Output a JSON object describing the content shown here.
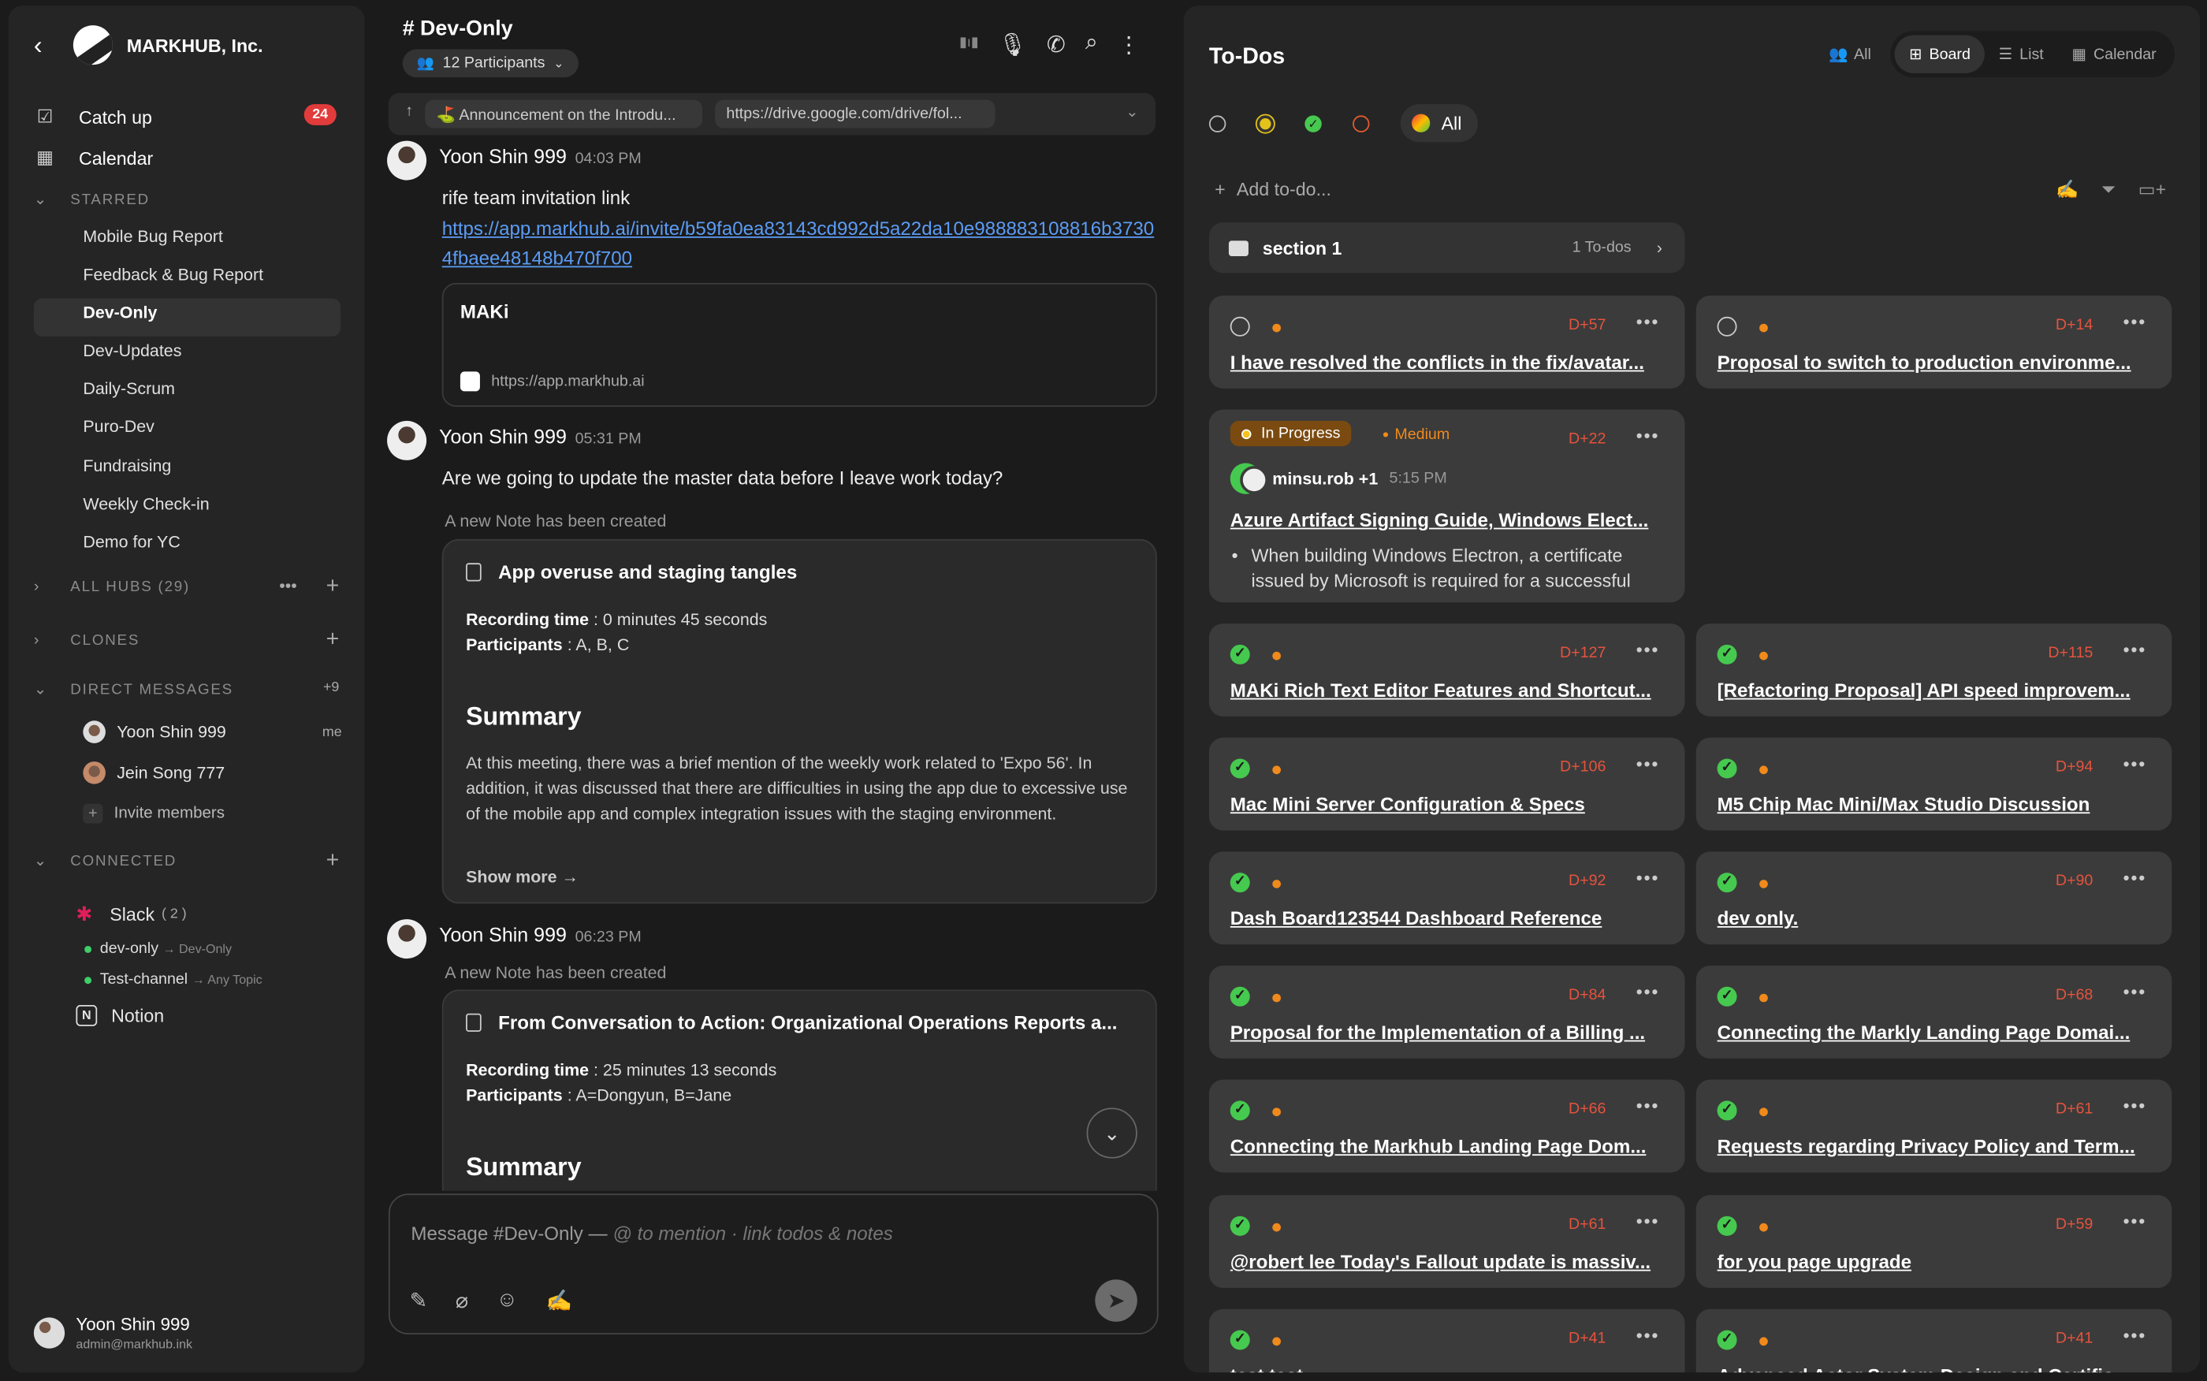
{
  "sidebar": {
    "org_name": "MARKHUB, Inc.",
    "nav": [
      {
        "label": "Catch up",
        "badge": "24"
      },
      {
        "label": "Calendar"
      }
    ],
    "starred_header": "STARRED",
    "channels": [
      "Mobile Bug Report",
      "Feedback & Bug Report",
      "Dev-Only",
      "Dev-Updates",
      "Daily-Scrum",
      "Puro-Dev",
      "Fundraising",
      "Weekly Check-in",
      "Demo for YC"
    ],
    "all_hubs": "ALL HUBS (29)",
    "clones": "CLONES",
    "dm_header": "DIRECT MESSAGES",
    "dm_count": "+9",
    "dms": [
      {
        "name": "Yoon Shin 999",
        "tag": "me"
      },
      {
        "name": "Jein Song 777",
        "tag": ""
      }
    ],
    "invite": "Invite members",
    "connected": "CONNECTED",
    "slack": {
      "name": "Slack",
      "count": "( 2 )"
    },
    "slack_channels": [
      {
        "name": "dev-only",
        "arrow": "→ Dev-Only"
      },
      {
        "name": "Test-channel",
        "arrow": "→ Any Topic"
      }
    ],
    "notion": "Notion",
    "user": {
      "name": "Yoon Shin 999",
      "email": "admin@markhub.ink"
    }
  },
  "chat": {
    "title": "# Dev-Only",
    "participants": "12 Participants",
    "pins": [
      "⛳ Announcement on the Introdu...",
      "https://drive.google.com/drive/fol..."
    ],
    "messages": [
      {
        "author": "Yoon Shin 999",
        "time": "04:03 PM",
        "text": "rife team invitation link",
        "link": "https://app.markhub.ai/invite/b59fa0ea83143cd992d5a22da10e988883108816b37304fbaee48148b470f700",
        "preview_title": "MAKi",
        "preview_url": "https://app.markhub.ai"
      },
      {
        "author": "Yoon Shin 999",
        "time": "05:31 PM",
        "text": "Are we going to update the master data before I leave work today?",
        "note_meta": "A new Note has been created",
        "note_title": "App overuse and staging tangles",
        "rec_label": "Recording time",
        "rec_value": " : 0 minutes 45 seconds",
        "part_label": "Participants",
        "part_value": " : A, B, C",
        "summary": "Summary",
        "summary_text": "At this meeting, there was a brief mention of the weekly work related to 'Expo 56'. In addition, it was discussed that there are difficulties in using the app due to excessive use of the mobile app and complex integration issues with the staging environment.",
        "show_more": "Show more →"
      },
      {
        "author": "Yoon Shin 999",
        "time": "06:23 PM",
        "note_meta": "A new Note has been created",
        "note_title": "From Conversation to Action: Organizational Operations Reports a...",
        "rec_label": "Recording time",
        "rec_value": " : 25 minutes 13 seconds",
        "part_label": "Participants",
        "part_value": " : A=Dongyun, B=Jane",
        "summary": "Summary"
      }
    ],
    "composer_placeholder": "Message #Dev-Only — ",
    "composer_hint": "@ to mention · link todos & notes"
  },
  "todos": {
    "title": "To-Dos",
    "views": [
      "All",
      "Board",
      "List",
      "Calendar"
    ],
    "selected_view": "Board",
    "filter_all": "All",
    "add_placeholder": "Add to-do...",
    "section": {
      "name": "section 1",
      "count": "1 To-dos"
    },
    "cards": [
      {
        "status": "open",
        "due": "D+57",
        "title": "I have resolved the conflicts in the fix/avatar..."
      },
      {
        "status": "open",
        "due": "D+14",
        "title": "Proposal to switch to production environme..."
      },
      {
        "status": "in_progress",
        "status_label": "In Progress",
        "priority": "Medium",
        "due": "D+22",
        "assignee": "minsu.rob +1",
        "time": "5:15 PM",
        "title": "Azure Artifact Signing Guide, Windows Elect...",
        "bullet": "When building Windows Electron, a certificate issued by Microsoft is required for a successful"
      },
      {
        "status": "done",
        "due": "D+127",
        "title": "MAKi Rich Text Editor Features and Shortcut..."
      },
      {
        "status": "done",
        "due": "D+115",
        "title": "[Refactoring Proposal] API speed improvem..."
      },
      {
        "status": "done",
        "due": "D+106",
        "title": "Mac Mini Server Configuration & Specs"
      },
      {
        "status": "done",
        "due": "D+94",
        "title": "M5 Chip Mac Mini/Max Studio Discussion"
      },
      {
        "status": "done",
        "due": "D+92",
        "title": "Dash Board123544 Dashboard Reference"
      },
      {
        "status": "done",
        "due": "D+90",
        "title": "dev only."
      },
      {
        "status": "done",
        "due": "D+84",
        "title": "Proposal for the Implementation of a Billing ..."
      },
      {
        "status": "done",
        "due": "D+68",
        "title": "Connecting the Markly Landing Page Domai..."
      },
      {
        "status": "done",
        "due": "D+66",
        "title": "Connecting the Markhub Landing Page Dom..."
      },
      {
        "status": "done",
        "due": "D+61",
        "title": "Requests regarding Privacy Policy and Term..."
      },
      {
        "status": "done",
        "due": "D+61",
        "title": "@robert lee Today's Fallout update is massiv..."
      },
      {
        "status": "done",
        "due": "D+59",
        "title": "for you page upgrade"
      },
      {
        "status": "done",
        "due": "D+41",
        "title": "test test"
      },
      {
        "status": "done",
        "due": "D+41",
        "title": "Advanced Actor System Design and Certific..."
      }
    ]
  },
  "colors": {
    "bg": "#1b1b1b",
    "panel": "#252525",
    "card": "#3b3b3b",
    "accent_red": "#e23b3b",
    "due": "#e5533d",
    "priority": "#f08a1c",
    "done": "#46c94f",
    "link": "#5b9cf5"
  }
}
